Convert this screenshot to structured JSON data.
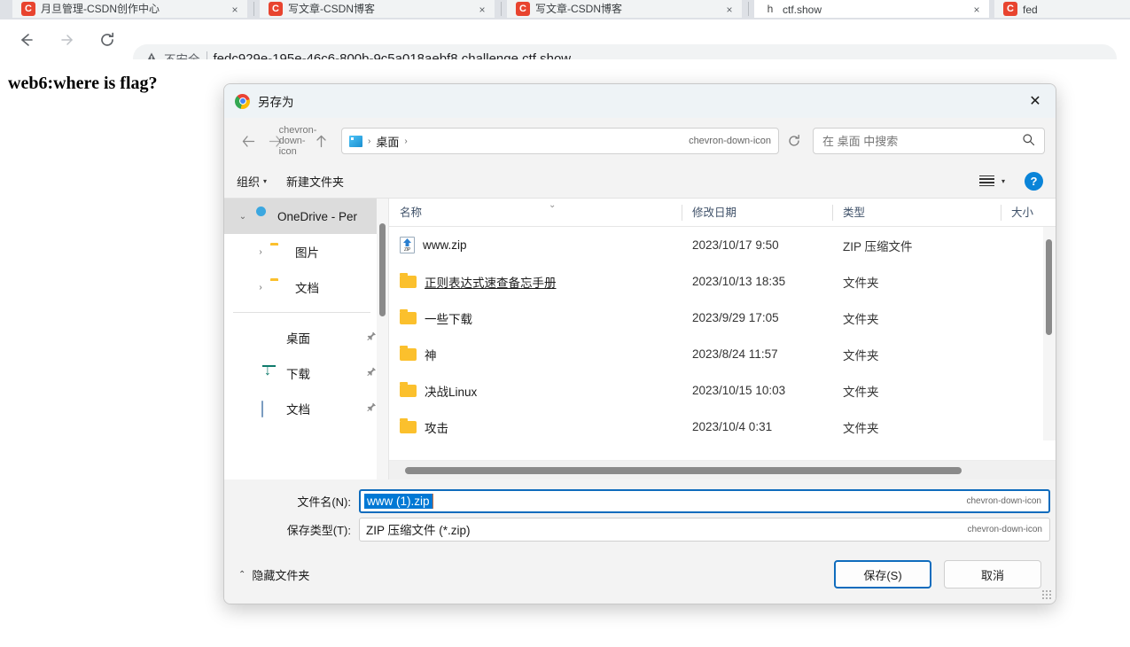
{
  "browser": {
    "tabs": [
      {
        "title": "月旦管理-CSDN创作中心",
        "favicon": "csdn-favicon",
        "close": "×",
        "active": false
      },
      {
        "title": "写文章-CSDN博客",
        "favicon": "csdn-favicon",
        "close": "×",
        "active": false
      },
      {
        "title": "写文章-CSDN博客",
        "favicon": "csdn-favicon",
        "close": "×",
        "active": false
      },
      {
        "title": "ctf.show",
        "favicon": "page-favicon",
        "close": "×",
        "active": true
      },
      {
        "title": "fed",
        "favicon": "csdn-favicon",
        "close": "×",
        "active": false
      }
    ],
    "toolbar": {
      "back_icon": "back-arrow-icon",
      "forward_icon": "forward-arrow-icon",
      "reload_icon": "reload-icon"
    },
    "omnibox": {
      "warning_icon": "warning-triangle-icon",
      "security_label": "不安全",
      "url": "fedc929e-195e-46c6-800b-9c5a018aebf8.challenge.ctf.show"
    }
  },
  "page": {
    "heading": "web6:where is flag?"
  },
  "dialog": {
    "title": "另存为",
    "close_label": "✕",
    "nav": {
      "back_icon": "back-arrow-icon",
      "forward_icon": "forward-arrow-icon",
      "recent_icon": "chevron-down-icon",
      "up_icon": "up-arrow-icon",
      "breadcrumb": {
        "location_icon": "desktop-icon",
        "separator": "›",
        "path": "桌面",
        "trailing_separator": "›",
        "dropdown_icon": "chevron-down-icon"
      },
      "refresh_icon": "refresh-icon",
      "search_placeholder": "在 桌面 中搜索",
      "search_value": "",
      "search_icon": "search-icon"
    },
    "toolbar": {
      "organize": "组织",
      "organize_caret": "▾",
      "new_folder": "新建文件夹",
      "view_icon": "view-list-icon",
      "view_caret": "▾",
      "help_label": "?"
    },
    "sidebar": {
      "items": [
        {
          "label": "OneDrive - Per",
          "icon": "cloud-icon",
          "expander": "⌄",
          "selected": true,
          "pinned": false,
          "indent": 0
        },
        {
          "label": "图片",
          "icon": "folder-icon",
          "expander": "›",
          "selected": false,
          "pinned": false,
          "indent": 1
        },
        {
          "label": "文档",
          "icon": "folder-icon",
          "expander": "›",
          "selected": false,
          "pinned": false,
          "indent": 1
        },
        {
          "label": "桌面",
          "icon": "desktop-icon",
          "expander": "",
          "selected": false,
          "pinned": true,
          "indent": 1
        },
        {
          "label": "下载",
          "icon": "download-icon",
          "expander": "",
          "selected": false,
          "pinned": true,
          "indent": 1
        },
        {
          "label": "文档",
          "icon": "documents-icon",
          "expander": "",
          "selected": false,
          "pinned": true,
          "indent": 1
        }
      ],
      "pin_glyph": "📌"
    },
    "file_list": {
      "columns": [
        "名称",
        "修改日期",
        "类型",
        "大小"
      ],
      "sort_indicator": "⌄",
      "rows": [
        {
          "name": "www.zip",
          "icon": "zip-file-icon",
          "date": "2023/10/17 9:50",
          "type": "ZIP 压缩文件",
          "size": "",
          "hovered": false
        },
        {
          "name": "正则表达式速查备忘手册",
          "icon": "folder-icon",
          "date": "2023/10/13 18:35",
          "type": "文件夹",
          "size": "",
          "hovered": true
        },
        {
          "name": "一些下载",
          "icon": "folder-icon",
          "date": "2023/9/29 17:05",
          "type": "文件夹",
          "size": "",
          "hovered": false
        },
        {
          "name": "神",
          "icon": "folder-icon",
          "date": "2023/8/24 11:57",
          "type": "文件夹",
          "size": "",
          "hovered": false
        },
        {
          "name": "决战Linux",
          "icon": "folder-icon",
          "date": "2023/10/15 10:03",
          "type": "文件夹",
          "size": "",
          "hovered": false
        },
        {
          "name": "攻击",
          "icon": "folder-icon",
          "date": "2023/10/4 0:31",
          "type": "文件夹",
          "size": "",
          "hovered": false
        }
      ]
    },
    "form": {
      "filename_label": "文件名(N):",
      "filename_value": "www (1).zip",
      "filetype_label": "保存类型(T):",
      "filetype_value": "ZIP 压缩文件 (*.zip)",
      "dropdown_icon": "chevron-down-icon"
    },
    "footer": {
      "hide_folders_caret": "⌃",
      "hide_folders": "隐藏文件夹",
      "save_button": "保存(S)",
      "cancel_button": "取消"
    }
  },
  "colors": {
    "accent": "#0f6cbd",
    "selection": "#0078d4",
    "folder": "#fbc02d",
    "help_blue": "#0a84d8"
  }
}
